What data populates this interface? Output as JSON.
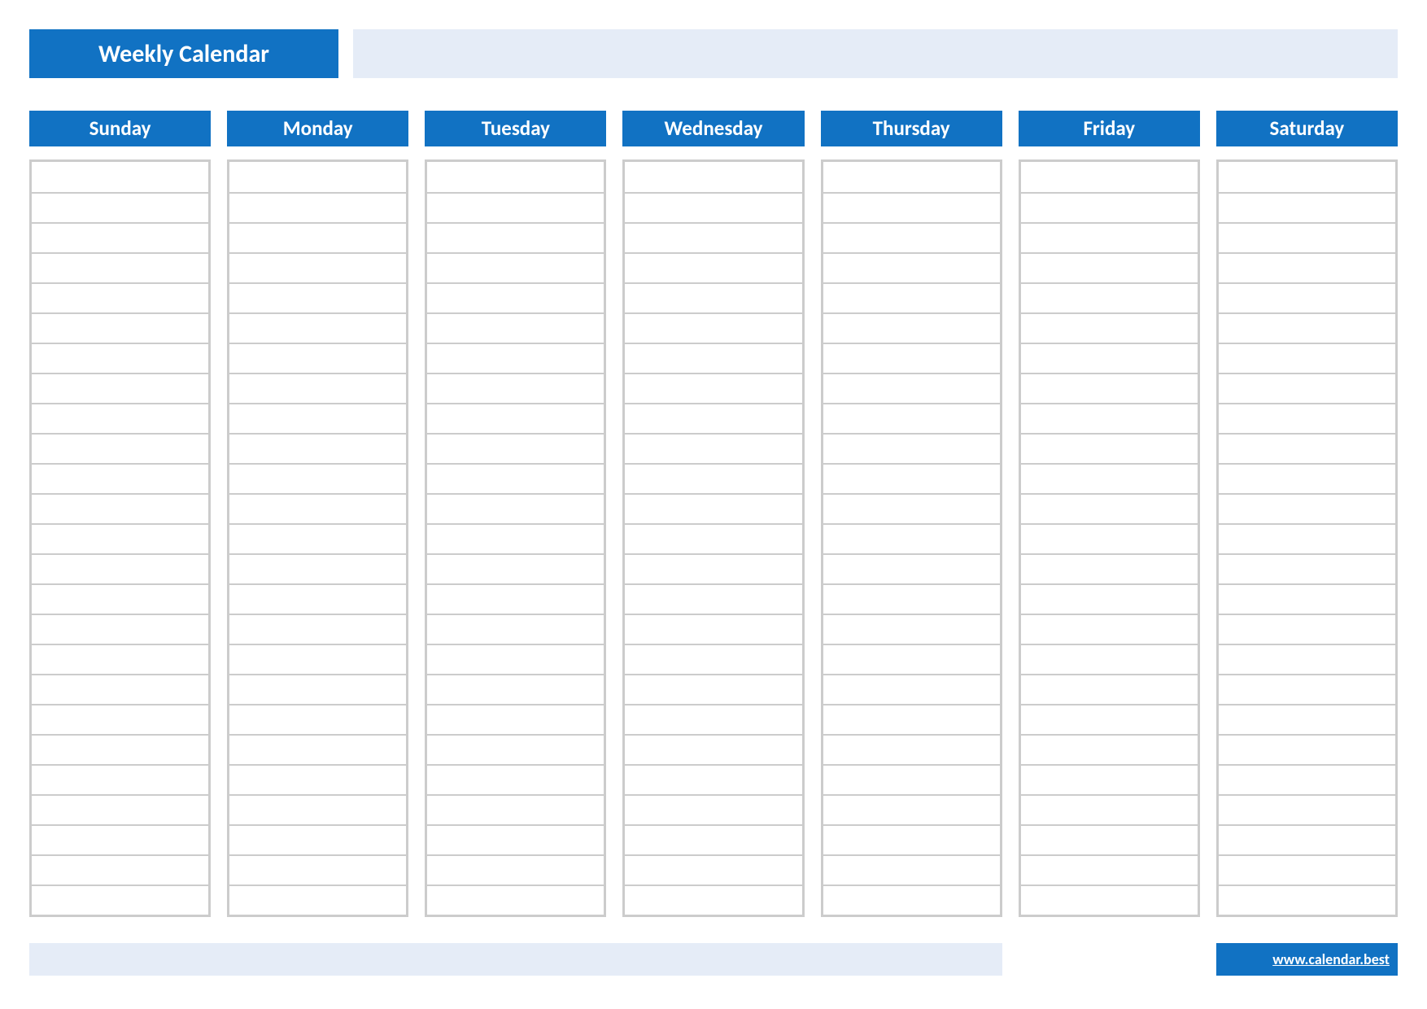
{
  "header": {
    "title": "Weekly Calendar"
  },
  "days": [
    {
      "label": "Sunday"
    },
    {
      "label": "Monday"
    },
    {
      "label": "Tuesday"
    },
    {
      "label": "Wednesday"
    },
    {
      "label": "Thursday"
    },
    {
      "label": "Friday"
    },
    {
      "label": "Saturday"
    }
  ],
  "slots_per_day": 25,
  "footer": {
    "link_text": "www.calendar.best"
  },
  "colors": {
    "brand_blue": "#1172c3",
    "light_blue": "#e5ecf7",
    "border_grey": "#cccccc"
  }
}
